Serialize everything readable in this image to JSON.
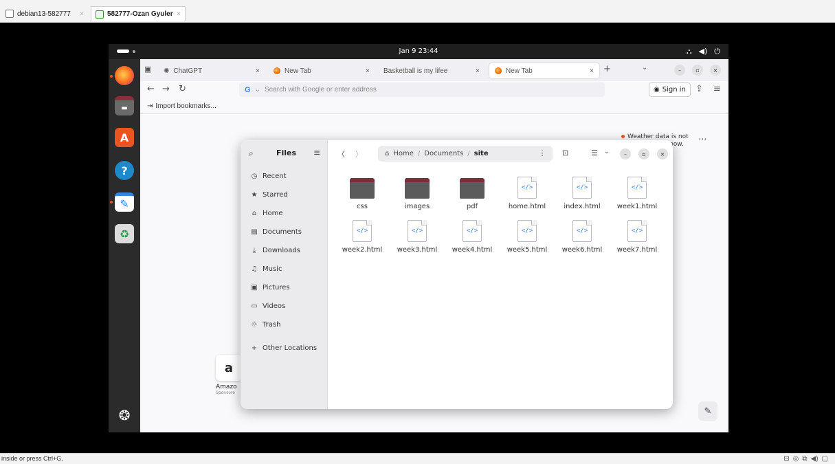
{
  "host": {
    "tabs": [
      {
        "label": "debian13-582777"
      },
      {
        "label": "582777-Ozan Gyuler"
      }
    ],
    "close_glyph": "×",
    "status_text": "inside or press Ctrl+G."
  },
  "ubuntu": {
    "clock": "Jan 9  23:44",
    "tray_icons": [
      "network-icon",
      "volume-icon",
      "power-icon"
    ],
    "dock": [
      "firefox",
      "files",
      "app-center",
      "help",
      "text-editor",
      "trash",
      "show-apps"
    ]
  },
  "firefox": {
    "tabs": [
      {
        "label": "ChatGPT"
      },
      {
        "label": "New Tab"
      },
      {
        "label": "Basketball is my lifee"
      },
      {
        "label": "New Tab"
      }
    ],
    "new_tab_glyph": "+",
    "url_placeholder": "Search with Google or enter address",
    "search_engine": "G",
    "sign_in": "Sign in",
    "bookmark_import": "Import bookmarks...",
    "weather_notice": "Weather data is not",
    "weather_notice_tail": "now.",
    "more_glyph": "...",
    "shortcut": {
      "glyph": "a",
      "label": "Amazo",
      "sublabel": "Sponsore"
    }
  },
  "files": {
    "title": "Files",
    "sidebar": [
      {
        "label": "Recent",
        "icon": "clock-icon",
        "glyph": "◷"
      },
      {
        "label": "Starred",
        "icon": "star-icon",
        "glyph": "★"
      },
      {
        "label": "Home",
        "icon": "home-icon",
        "glyph": "⌂"
      },
      {
        "label": "Documents",
        "icon": "document-icon",
        "glyph": "▤"
      },
      {
        "label": "Downloads",
        "icon": "download-icon",
        "glyph": "⤓"
      },
      {
        "label": "Music",
        "icon": "music-icon",
        "glyph": "♫"
      },
      {
        "label": "Pictures",
        "icon": "picture-icon",
        "glyph": "▣"
      },
      {
        "label": "Videos",
        "icon": "video-icon",
        "glyph": "▭"
      },
      {
        "label": "Trash",
        "icon": "trash-icon",
        "glyph": "♲"
      },
      {
        "label": "Other Locations",
        "icon": "plus-icon",
        "glyph": "+"
      }
    ],
    "breadcrumb": {
      "home": "Home",
      "sep": "/",
      "documents": "Documents",
      "current": "site"
    },
    "items": [
      {
        "name": "css",
        "kind": "folder"
      },
      {
        "name": "images",
        "kind": "folder"
      },
      {
        "name": "pdf",
        "kind": "folder"
      },
      {
        "name": "home.html",
        "kind": "html"
      },
      {
        "name": "index.html",
        "kind": "html"
      },
      {
        "name": "week1.html",
        "kind": "html"
      },
      {
        "name": "week2.html",
        "kind": "html"
      },
      {
        "name": "week3.html",
        "kind": "html"
      },
      {
        "name": "week4.html",
        "kind": "html"
      },
      {
        "name": "week5.html",
        "kind": "html"
      },
      {
        "name": "week6.html",
        "kind": "html"
      },
      {
        "name": "week7.html",
        "kind": "html"
      }
    ],
    "html_glyph": "</>"
  }
}
